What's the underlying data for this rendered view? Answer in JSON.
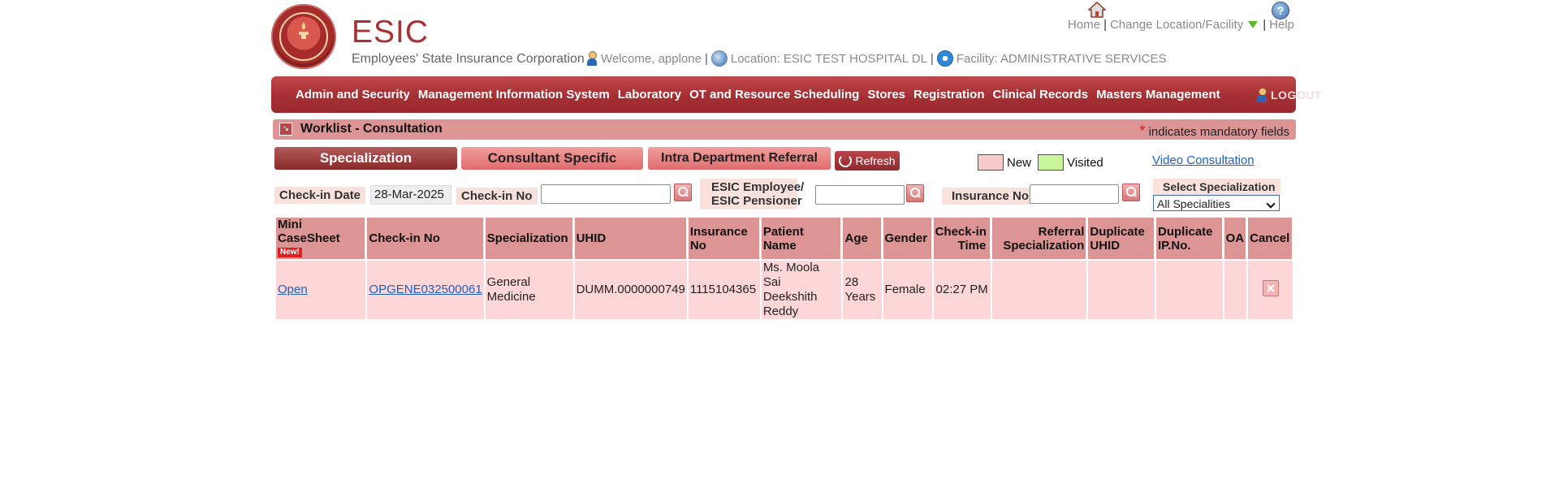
{
  "header": {
    "brand_title": "ESIC",
    "brand_subtitle": "Employees' State Insurance Corporation",
    "welcome": "Welcome, applone",
    "location": "Location: ESIC TEST HOSPITAL DL",
    "facility": "Facility: ADMINISTRATIVE SERVICES",
    "links": {
      "home": "Home",
      "change_location": "Change Location/Facility",
      "help": "Help"
    },
    "help_icon_glyph": "?"
  },
  "menu": {
    "items": [
      "Admin and Security",
      "Management Information System",
      "Laboratory",
      "OT and Resource Scheduling",
      "Stores",
      "Registration",
      "Clinical Records",
      "Masters Management"
    ],
    "logout": "LOGOUT"
  },
  "worklist": {
    "title": "Worklist - Consultation",
    "mandatory_star": "*",
    "mandatory_note": "indicates mandatory fields",
    "tabs": {
      "specialization": "Specialization",
      "consultant": "Consultant Specific",
      "intra": "Intra Department Referral"
    },
    "refresh": "Refresh",
    "legend": {
      "new": "New",
      "visited": "Visited",
      "new_color": "#f9caca",
      "visited_color": "#c9f59a"
    },
    "video_consultation": "Video Consultation"
  },
  "filters": {
    "checkin_date_label": "Check-in Date",
    "checkin_date_value": "28-Mar-2025",
    "checkin_no_label": "Check-in No",
    "checkin_no_value": "",
    "esic_label_1": "ESIC Employee/",
    "esic_label_2": "ESIC Pensioner",
    "esic_value": "",
    "insurance_label": "Insurance No",
    "insurance_value": "",
    "specialization_label": "Select Specialization",
    "specialization_value": "All Specialities"
  },
  "table": {
    "headers": {
      "mini_1": "Mini",
      "mini_2": "CaseSheet",
      "new_badge": "New!",
      "checkin_no": "Check-in No",
      "specialization": "Specialization",
      "uhid": "UHID",
      "insurance_1": "Insurance",
      "insurance_2": "No",
      "patient_name": "Patient Name",
      "age": "Age",
      "gender": "Gender",
      "checkin_time_1": "Check-in",
      "checkin_time_2": "Time",
      "referral_1": "Referral",
      "referral_2": "Specialization",
      "dup_uhid_1": "Duplicate",
      "dup_uhid_2": "UHID",
      "dup_ip_1": "Duplicate",
      "dup_ip_2": "IP.No.",
      "oa": "OA",
      "cancel": "Cancel"
    },
    "rows": [
      {
        "open": "Open",
        "checkin_no": "OPGENE032500061",
        "specialization_1": "General",
        "specialization_2": "Medicine",
        "uhid": "DUMM.0000000749",
        "insurance_no": "1115104365",
        "patient_1": "Ms. Moola Sai",
        "patient_2": "Deekshith",
        "patient_3": "Reddy",
        "age_1": "28",
        "age_2": "Years",
        "gender": "Female",
        "checkin_time": "02:27 PM",
        "referral": "",
        "dup_uhid": "",
        "dup_ip": "",
        "oa": ""
      }
    ]
  }
}
